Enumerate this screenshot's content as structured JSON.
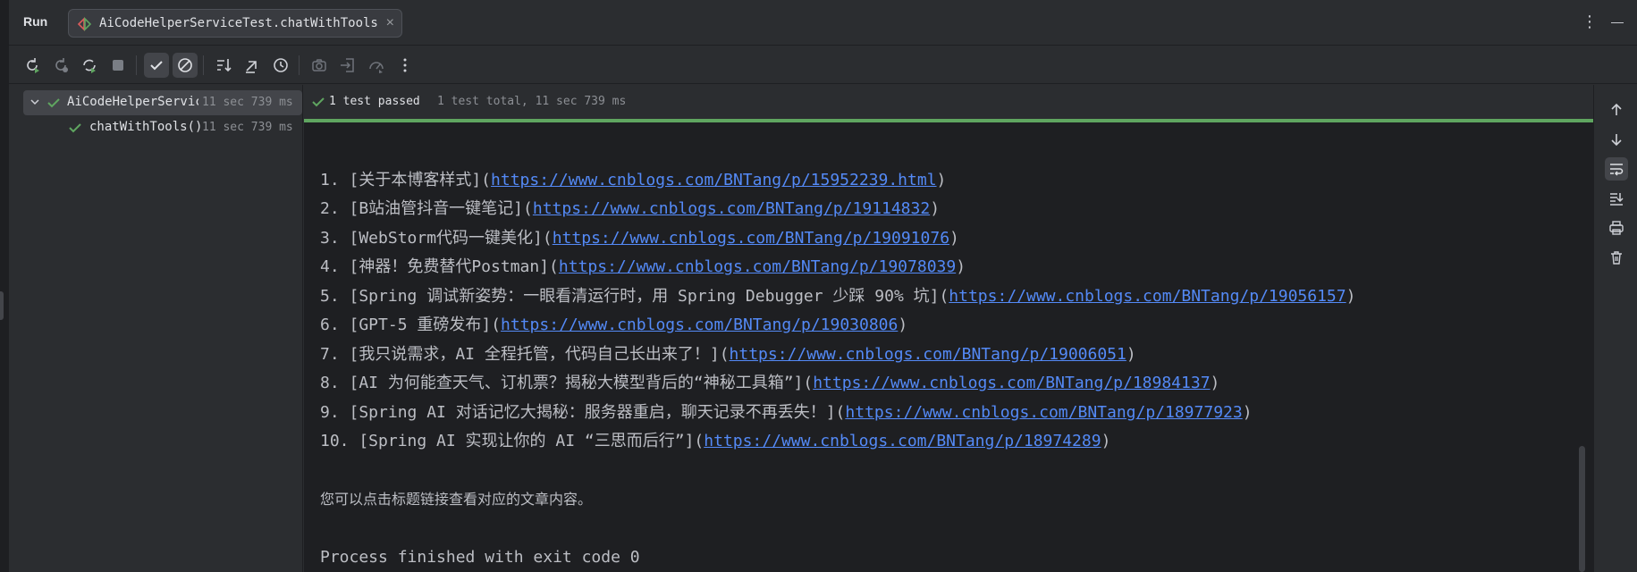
{
  "header": {
    "run_title": "Run",
    "tab_label": "AiCodeHelperServiceTest.chatWithTools",
    "tab_close": "×",
    "more_glyph": "⋮",
    "minimize_glyph": "—"
  },
  "toolbar": {
    "buttons": [
      "rerun-icon",
      "rerun-failed-icon",
      "toggle-auto-test-icon",
      "stop-icon",
      "show-passed-icon",
      "show-ignored-icon",
      "sort-icon",
      "collapse-all-icon",
      "history-icon",
      "screenshot-icon",
      "import-tests-icon",
      "coverage-icon",
      "more-icon"
    ]
  },
  "tree": {
    "root": {
      "name": "AiCodeHelperServiceTest",
      "time": "11 sec 739 ms"
    },
    "child": {
      "name": "chatWithTools()",
      "time": "11 sec 739 ms"
    }
  },
  "status": {
    "passed": "1 test passed",
    "total": "1 test total, 11 sec 739 ms",
    "progress": 1.0
  },
  "output": {
    "items": [
      {
        "prefix": "1. [关于本博客样式](",
        "link": "https://www.cnblogs.com/BNTang/p/15952239.html",
        "suffix": ")"
      },
      {
        "prefix": "2. [B站油管抖音一键笔记](",
        "link": "https://www.cnblogs.com/BNTang/p/19114832",
        "suffix": ")"
      },
      {
        "prefix": "3. [WebStorm代码一键美化](",
        "link": "https://www.cnblogs.com/BNTang/p/19091076",
        "suffix": ")"
      },
      {
        "prefix": "4. [神器！免费替代Postman](",
        "link": "https://www.cnblogs.com/BNTang/p/19078039",
        "suffix": ")"
      },
      {
        "prefix": "5. [Spring 调试新姿势：一眼看清运行时，用 Spring Debugger 少踩 90% 坑](",
        "link": "https://www.cnblogs.com/BNTang/p/19056157",
        "suffix": ")"
      },
      {
        "prefix": "6. [GPT-5 重磅发布](",
        "link": "https://www.cnblogs.com/BNTang/p/19030806",
        "suffix": ")"
      },
      {
        "prefix": "7. [我只说需求，AI 全程托管，代码自己长出来了！](",
        "link": "https://www.cnblogs.com/BNTang/p/19006051",
        "suffix": ")"
      },
      {
        "prefix": "8. [AI 为何能查天气、订机票？揭秘大模型背后的“神秘工具箱”](",
        "link": "https://www.cnblogs.com/BNTang/p/18984137",
        "suffix": ")"
      },
      {
        "prefix": "9. [Spring AI 对话记忆大揭秘：服务器重启，聊天记录不再丢失！](",
        "link": "https://www.cnblogs.com/BNTang/p/18977923",
        "suffix": ")"
      },
      {
        "prefix": "10. [Spring AI 实现让你的 AI “三思而后行”](",
        "link": "https://www.cnblogs.com/BNTang/p/18974289",
        "suffix": ")"
      }
    ],
    "note": "您可以点击标题链接查看对应的文章内容。",
    "exit": "Process finished with exit code 0"
  },
  "colors": {
    "accent_green": "#5fa560",
    "link_blue": "#548af7",
    "background": "#1e1f22",
    "panel": "#2b2d30"
  }
}
